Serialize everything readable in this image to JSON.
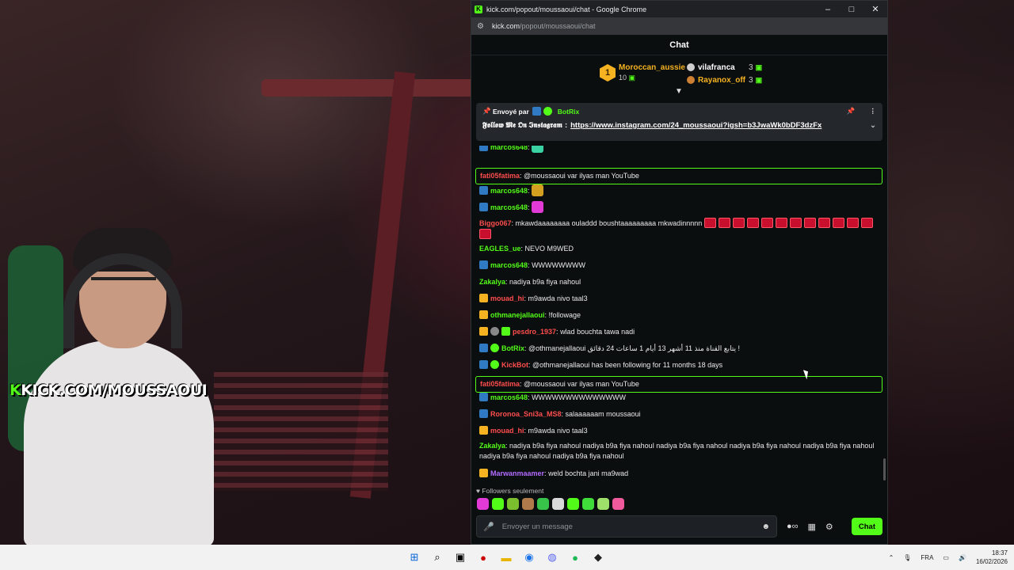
{
  "window": {
    "title": "kick.com/popout/moussaoui/chat - Google Chrome",
    "url_host": "kick.com",
    "url_path": "/popout/moussaoui/chat",
    "minimize": "–",
    "maximize": "□",
    "close": "✕"
  },
  "stream": {
    "watermark_k": "K",
    "watermark": "KICK.COM/MOUSSAOUI"
  },
  "chat": {
    "header": "Chat",
    "leaderboard": {
      "first": {
        "rank": "1",
        "name": "Moroccan_aussie",
        "count": "10"
      },
      "second": {
        "name": "vilafranca",
        "count": "3"
      },
      "third": {
        "name": "Rayanox_off",
        "count": "3"
      }
    },
    "pinned": {
      "sent_by": "Envoyé par",
      "sender": "BotRix",
      "prefix": "𝕱𝖔𝖑𝖑𝖔𝖜 𝕸𝖊 𝕺𝖓 𝕴𝖓𝖘𝖙𝖆𝖌𝖗𝖆𝖒",
      "separator": ":",
      "link": "https://www.instagram.com/24_moussaoui?igsh=b3JwaWk0bDF3dzFx"
    },
    "messages": [
      {
        "user": "marcos648",
        "color": "#53fc18",
        "text": "",
        "badge": "edit",
        "emote": "green"
      },
      {
        "user": "fati05fatima",
        "color": "#ff4d4d",
        "text": "@moussaoui var ilyas man YouTube",
        "highlight": true
      },
      {
        "user": "marcos648",
        "color": "#53fc18",
        "text": "",
        "badge": "edit",
        "emote": "gold"
      },
      {
        "user": "marcos648",
        "color": "#53fc18",
        "text": "",
        "badge": "edit",
        "emote": "pink"
      },
      {
        "user": "Biggo067",
        "color": "#ff4d4d",
        "text": "mkawdaaaaaaaa ouladdd boushtaaaaaaaaa mkwadinnnnn",
        "red_emotes": 13
      },
      {
        "user": "EAGLES_ue",
        "color": "#53fc18",
        "text": "NEVO M9WED"
      },
      {
        "user": "marcos648",
        "color": "#53fc18",
        "text": "WWWWWWWW",
        "badge": "edit"
      },
      {
        "user": "Zakalya",
        "color": "#53fc18",
        "text": "nadiya b9a fiya nahoul"
      },
      {
        "user": "mouad_hi",
        "color": "#ff4d4d",
        "text": "m9awda nivo taal3",
        "badge": "crown"
      },
      {
        "user": "othmanejallaoui",
        "color": "#53fc18",
        "text": "!followage",
        "badge": "crown"
      },
      {
        "user": "pesdro_1937",
        "color": "#ff4d4d",
        "text": "wlad bouchta tawa nadi",
        "badge": "crown",
        "extra": true
      },
      {
        "user": "BotRix",
        "color": "#53fc18",
        "text": "@othmanejallaoui يتابع القناة منذ 11 أشهر 13 أيام 1 ساعات 24 دقائق !",
        "badge": "edit",
        "verified": true
      },
      {
        "user": "KickBot",
        "color": "#ff4d4d",
        "text": "@othmanejallaoui has been following for 11 months 18 days",
        "badge": "edit",
        "verified": true
      },
      {
        "user": "fati05fatima",
        "color": "#ff4d4d",
        "text": "@moussaoui var ilyas man YouTube",
        "highlight": true
      },
      {
        "user": "marcos648",
        "color": "#53fc18",
        "text": "WWWWWWWWWWWWWW",
        "badge": "edit"
      },
      {
        "user": "Roronoa_Sni3a_MS8",
        "color": "#ff4d4d",
        "text": "salaaaaaam moussaoui",
        "badge": "edit"
      },
      {
        "user": "mouad_hi",
        "color": "#ff4d4d",
        "text": "m9awda nivo taal3",
        "badge": "crown"
      },
      {
        "user": "Zakalya",
        "color": "#53fc18",
        "text": "nadiya b9a fiya nahoul nadiya b9a fiya nahoul nadiya b9a fiya nahoul nadiya b9a fiya nahoul nadiya b9a fiya nahoul nadiya b9a fiya nahoul nadiya b9a fiya nahoul"
      },
      {
        "user": "Marwanmaamer",
        "color": "#b36bff",
        "text": "weld bochta jani ma9wad",
        "badge": "crown"
      }
    ],
    "followers_only": "Followers seulement",
    "input_placeholder": "Envoyer un message",
    "send_label": "Chat"
  },
  "taskbar": {
    "language": "FRA",
    "time": "18:37",
    "date": "16/02/2026"
  },
  "colors": {
    "accent": "#53fc18",
    "background": "#0b0e0f"
  }
}
